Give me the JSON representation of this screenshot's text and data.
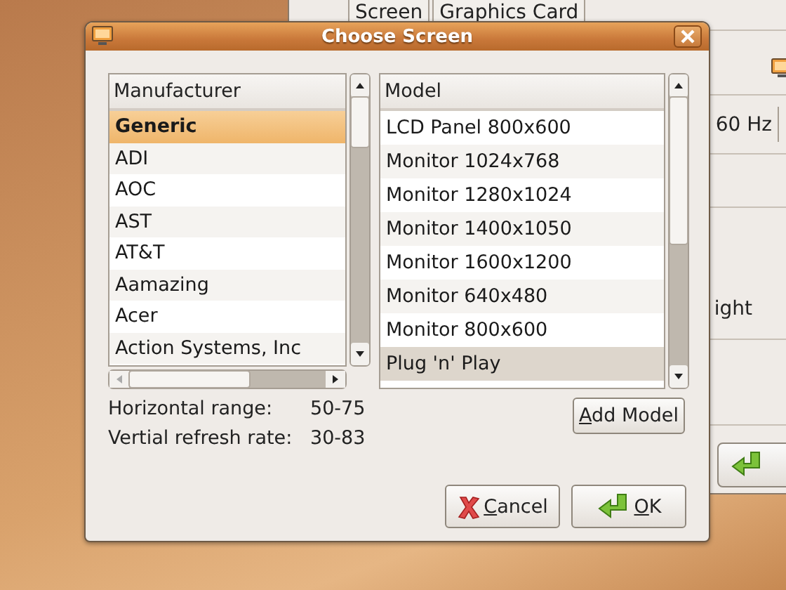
{
  "background_window": {
    "tabs": [
      {
        "label": "Screen"
      },
      {
        "label": "Graphics Card"
      }
    ],
    "refresh_field": "60 Hz",
    "label_fragment": "ight"
  },
  "dialog": {
    "title": "Choose Screen",
    "manufacturers": {
      "header": "Manufacturer",
      "focused": true,
      "items": [
        {
          "label": "Generic",
          "selected": true
        },
        {
          "label": "ADI",
          "selected": false
        },
        {
          "label": "AOC",
          "selected": false
        },
        {
          "label": "AST",
          "selected": false
        },
        {
          "label": "AT&T",
          "selected": false
        },
        {
          "label": "Aamazing",
          "selected": false
        },
        {
          "label": "Acer",
          "selected": false
        },
        {
          "label": "Action Systems, Inc",
          "selected": false
        }
      ]
    },
    "models": {
      "header": "Model",
      "focused": false,
      "items": [
        {
          "label": "LCD Panel 800x600",
          "selected": false
        },
        {
          "label": "Monitor 1024x768",
          "selected": false
        },
        {
          "label": "Monitor 1280x1024",
          "selected": false
        },
        {
          "label": "Monitor 1400x1050",
          "selected": false
        },
        {
          "label": "Monitor 1600x1200",
          "selected": false
        },
        {
          "label": "Monitor 640x480",
          "selected": false
        },
        {
          "label": "Monitor 800x600",
          "selected": false
        },
        {
          "label": "Plug 'n' Play",
          "selected": true
        }
      ]
    },
    "info": [
      {
        "label": "Horizontal range:",
        "value": "50-75"
      },
      {
        "label": "Vertial refresh rate:",
        "value": "30-83"
      }
    ],
    "add_button": "Add Model",
    "buttons": [
      {
        "kind": "cancel",
        "label": "Cancel"
      },
      {
        "kind": "ok",
        "label": "OK"
      }
    ]
  }
}
